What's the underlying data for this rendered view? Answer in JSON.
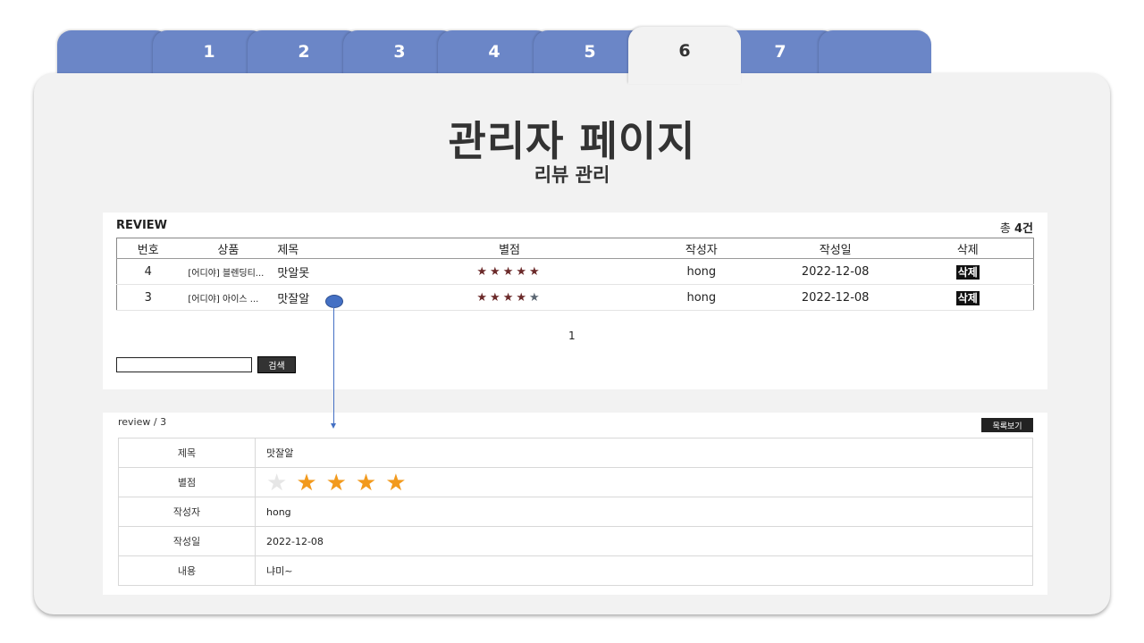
{
  "tabs": [
    {
      "label": ""
    },
    {
      "label": "1"
    },
    {
      "label": "2"
    },
    {
      "label": "3"
    },
    {
      "label": "4"
    },
    {
      "label": "5"
    },
    {
      "label": "6",
      "active": true
    },
    {
      "label": "7"
    },
    {
      "label": ""
    }
  ],
  "page": {
    "title": "관리자 페이지",
    "subtitle": "리뷰 관리"
  },
  "review_list": {
    "section_label": "REVIEW",
    "total_prefix": "총 ",
    "total_count": "4건",
    "columns": [
      "번호",
      "상품",
      "제목",
      "별점",
      "작성자",
      "작성일",
      "삭제"
    ],
    "rows": [
      {
        "no": "4",
        "product": "[어디야] 블렌딩티...",
        "title": "맛알못",
        "rating": 5,
        "author": "hong",
        "date": "2022-12-08",
        "delete_label": "삭제"
      },
      {
        "no": "3",
        "product": "[어디야] 아이스 ...",
        "title": "맛잘알",
        "rating": 4,
        "author": "hong",
        "date": "2022-12-08",
        "delete_label": "삭제"
      }
    ],
    "pagination": "1",
    "search_value": "",
    "search_button": "검색"
  },
  "review_detail": {
    "breadcrumb": "review / 3",
    "list_button": "목록보기",
    "fields": [
      {
        "label": "제목",
        "value": "맛잘알"
      },
      {
        "label": "별점",
        "rating": 4
      },
      {
        "label": "작성자",
        "value": "hong"
      },
      {
        "label": "작성일",
        "value": "2022-12-08"
      },
      {
        "label": "내용",
        "value": "냐미~"
      }
    ]
  },
  "colors": {
    "tab": "#6b86c7",
    "panel": "#f2f2f2",
    "star_gold": "#f29a1e",
    "connector": "#4470c4"
  }
}
